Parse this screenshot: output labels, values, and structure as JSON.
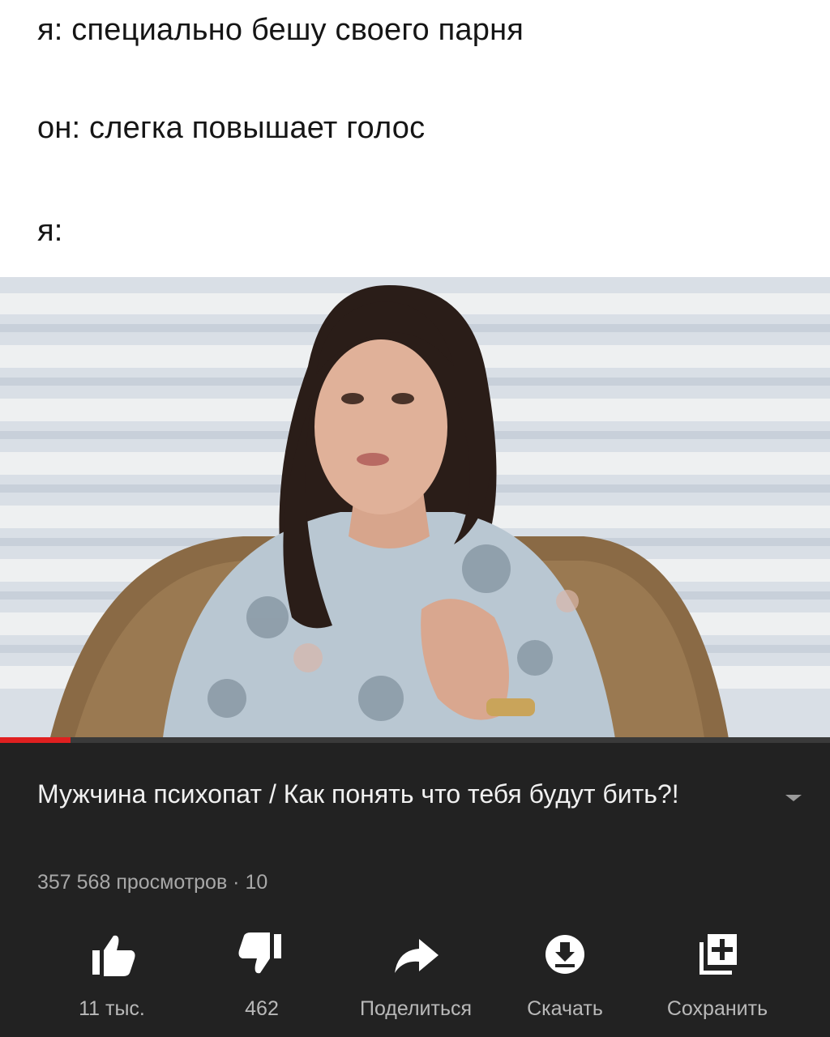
{
  "caption": {
    "line1": "я: специально бешу своего парня",
    "line2": "он: слегка повышает голос",
    "line3": "я:"
  },
  "video": {
    "progress_fraction": 0.085,
    "progress_color": "#e02020"
  },
  "info": {
    "title": "Мужчина психопат / Как понять что тебя будут бить?!",
    "meta": "357 568 просмотров · 10",
    "expand_icon": "chevron-down-icon"
  },
  "actions": [
    {
      "icon": "thumbs-up-icon",
      "label": "11 тыс."
    },
    {
      "icon": "thumbs-down-icon",
      "label": "462"
    },
    {
      "icon": "share-icon",
      "label": "Поделиться"
    },
    {
      "icon": "download-icon",
      "label": "Скачать"
    },
    {
      "icon": "playlist-add-icon",
      "label": "Сохранить"
    }
  ]
}
